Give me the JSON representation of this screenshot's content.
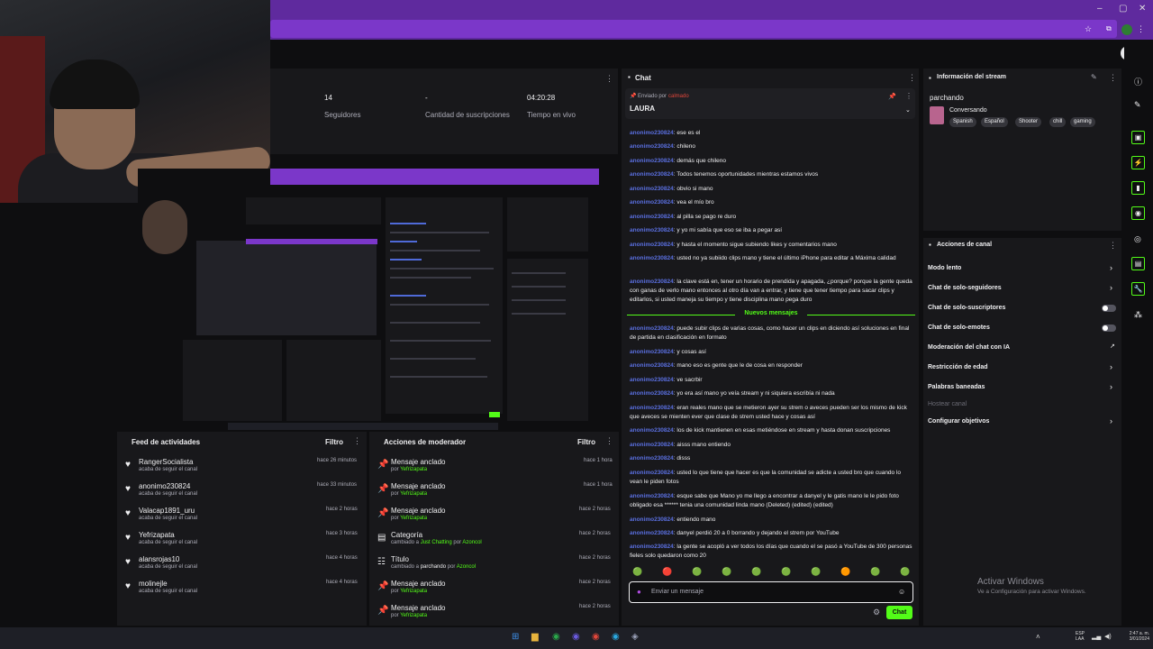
{
  "stats": [
    {
      "value": "14",
      "label": "Seguidores"
    },
    {
      "value": "-",
      "label": "Cantidad de suscripciones"
    },
    {
      "value": "04:20:28",
      "label": "Tiempo en vivo"
    }
  ],
  "activity_feed": {
    "title": "Feed de actividades",
    "filter": "Filtro",
    "items": [
      {
        "name": "RangerSocialista",
        "sub": "acaba de seguir el canal",
        "time": "hace 26 minutos"
      },
      {
        "name": "anonimo230824",
        "sub": "acaba de seguir el canal",
        "time": "hace 33 minutos"
      },
      {
        "name": "Valacap1891_uru",
        "sub": "acaba de seguir el canal",
        "time": "hace 2 horas"
      },
      {
        "name": "Yefrizapata",
        "sub": "acaba de seguir el canal",
        "time": "hace 3 horas"
      },
      {
        "name": "alansrojas10",
        "sub": "acaba de seguir el canal",
        "time": "hace 4 horas"
      },
      {
        "name": "molinejle",
        "sub": "acaba de seguir el canal",
        "time": "hace 4 horas"
      }
    ]
  },
  "mod_actions": {
    "title": "Acciones de moderador",
    "filter": "Filtro",
    "items": [
      {
        "icon": "pin-icon",
        "name": "Mensaje anclado",
        "pre": "por",
        "hl": "Yefrizapata",
        "mid": "",
        "hl2": "",
        "time": "hace 1 hora"
      },
      {
        "icon": "pin-icon",
        "name": "Mensaje anclado",
        "pre": "por",
        "hl": "Yefrizapata",
        "mid": "",
        "hl2": "",
        "time": "hace 1 hora"
      },
      {
        "icon": "pin-icon",
        "name": "Mensaje anclado",
        "pre": "por",
        "hl": "Yefrizapata",
        "mid": "",
        "hl2": "",
        "time": "hace 2 horas"
      },
      {
        "icon": "category-icon",
        "name": "Categoría",
        "pre": "cambiado a",
        "hl": "Just Chatting",
        "mid": "por",
        "hl2": "Azoncol",
        "time": "hace 2 horas"
      },
      {
        "icon": "title-icon",
        "name": "Título",
        "pre": "cambiado a",
        "hl": "parchando",
        "mid": "por",
        "hl2": "Azoncol",
        "time": "hace 2 horas"
      },
      {
        "icon": "pin-icon",
        "name": "Mensaje anclado",
        "pre": "por",
        "hl": "Yefrizapata",
        "mid": "",
        "hl2": "",
        "time": "hace 2 horas"
      },
      {
        "icon": "pin-icon",
        "name": "Mensaje anclado",
        "pre": "por",
        "hl": "Yefrizapata",
        "mid": "",
        "hl2": "",
        "time": "hace 2 horas"
      }
    ]
  },
  "chat": {
    "title": "Chat",
    "pinned_by_label": "Enviado por",
    "pinned_by_user": "calmado",
    "pinned_text": "LAURA",
    "messages": [
      {
        "user": "anonimo230824",
        "text": "ese es el"
      },
      {
        "user": "anonimo230824",
        "text": "chileno"
      },
      {
        "user": "anonimo230824",
        "text": "demás que chileno"
      },
      {
        "user": "anonimo230824",
        "text": "Todos tenemos oportunidades mientras estamos vivos"
      },
      {
        "user": "anonimo230824",
        "text": "obvio si mano"
      },
      {
        "user": "anonimo230824",
        "text": "vea el mío bro"
      },
      {
        "user": "anonimo230824",
        "text": "al pilla se pago re duro"
      },
      {
        "user": "anonimo230824",
        "text": "y yo mi sabía que eso se iba a pegar así"
      },
      {
        "user": "anonimo230824",
        "text": "y hasta el momento sigue subiendo likes y comentarios mano"
      },
      {
        "user": "anonimo230824",
        "text": "usted no ya subiido clips mano y tiene el último iPhone para editar a Máxima calidad"
      },
      {
        "user": "anonimo230824",
        "text": "la clave está en, tener un horario de prendida y apagada, ¿porque? porque la gente queda con ganas de verlo mano entonces al otro día van a entrar, y tiene que tener tiempo para sacar clips y editarlos, si usted maneja su tiempo y tiene disciplina mano pega duro"
      }
    ],
    "new_messages_label": "Nuevos mensajes",
    "messages2": [
      {
        "user": "anonimo230824",
        "text": "puede subir clips de varias cosas, como hacer un clips en diciendo así soluciones en final de partida en clasificación en formato"
      },
      {
        "user": "anonimo230824",
        "text": "y cosas así"
      },
      {
        "user": "anonimo230824",
        "text": "mano eso es gente que le de cosa en responder"
      },
      {
        "user": "anonimo230824",
        "text": "ve sacrbir"
      },
      {
        "user": "anonimo230824",
        "text": "yo era así mano yo veía stream y ni siquiera escribía ni nada"
      },
      {
        "user": "anonimo230824",
        "text": "eran reales mano que se metieron ayer su strem o aveces pueden ser los mismo de kick que aveces se mienten ever que clase de strem usted hace y cosas así"
      },
      {
        "user": "anonimo230824",
        "text": "los de kick mantienen en esas metiéndose en stream y hasta donan suscripciones"
      },
      {
        "user": "anonimo230824",
        "text": "aisss mano entiendo"
      },
      {
        "user": "anonimo230824",
        "text": "disss"
      },
      {
        "user": "anonimo230824",
        "text": "usted lo que tiene que hacer es que la comunidad se adicte a usted bro que cuando lo vean le piden fotos"
      },
      {
        "user": "anonimo230824",
        "text": "esque sabe que Mano yo me llego a encontrar a danyel y le gatis mano le le pido foto obligado esa ****** tenia una comunidad linda mano (Deleted) (edited) (edited)"
      },
      {
        "user": "anonimo230824",
        "text": "entiendo mano"
      },
      {
        "user": "anonimo230824",
        "text": "danyel perdió 20 a 0 borrando y dejando el strem por YouTube"
      },
      {
        "user": "anonimo230824",
        "text": "la gente se acopló a ver todos los días que cuando el se pasó a YouTube de 300 personas fieles solo quedaron como 20"
      }
    ],
    "input_placeholder": "Enviar un mensaje",
    "send_label": "Chat"
  },
  "stream_info": {
    "title": "Información del stream",
    "stream_title": "parchando",
    "category": "Conversando",
    "tags": [
      "Spanish",
      "Español",
      "Shooter",
      "chill",
      "gaming"
    ]
  },
  "channel_actions": {
    "title": "Acciones de canal",
    "items": [
      {
        "label": "Modo lento",
        "type": "chevron"
      },
      {
        "label": "Chat de solo-seguidores",
        "type": "chevron"
      },
      {
        "label": "Chat de solo-suscriptores",
        "type": "toggle"
      },
      {
        "label": "Chat de solo-emotes",
        "type": "toggle"
      },
      {
        "label": "Moderación del chat con IA",
        "type": "external"
      },
      {
        "label": "Restricción de edad",
        "type": "chevron"
      },
      {
        "label": "Palabras baneadas",
        "type": "chevron"
      },
      {
        "label": "Hostear canal",
        "type": "dim"
      },
      {
        "label": "Configurar objetivos",
        "type": "chevron"
      }
    ]
  },
  "windows_watermark": {
    "line1": "Activar Windows",
    "line2": "Ve a Configuración para activar Windows."
  },
  "taskbar": {
    "lang_line1": "ESP",
    "lang_line2": "LAA",
    "time": "2:47 a. m.",
    "date": "3/01/2024"
  },
  "colors": {
    "accent": "#53fc18",
    "mention": "#5a6fe0",
    "purple": "#7b37c9",
    "panel": "#18181b"
  }
}
